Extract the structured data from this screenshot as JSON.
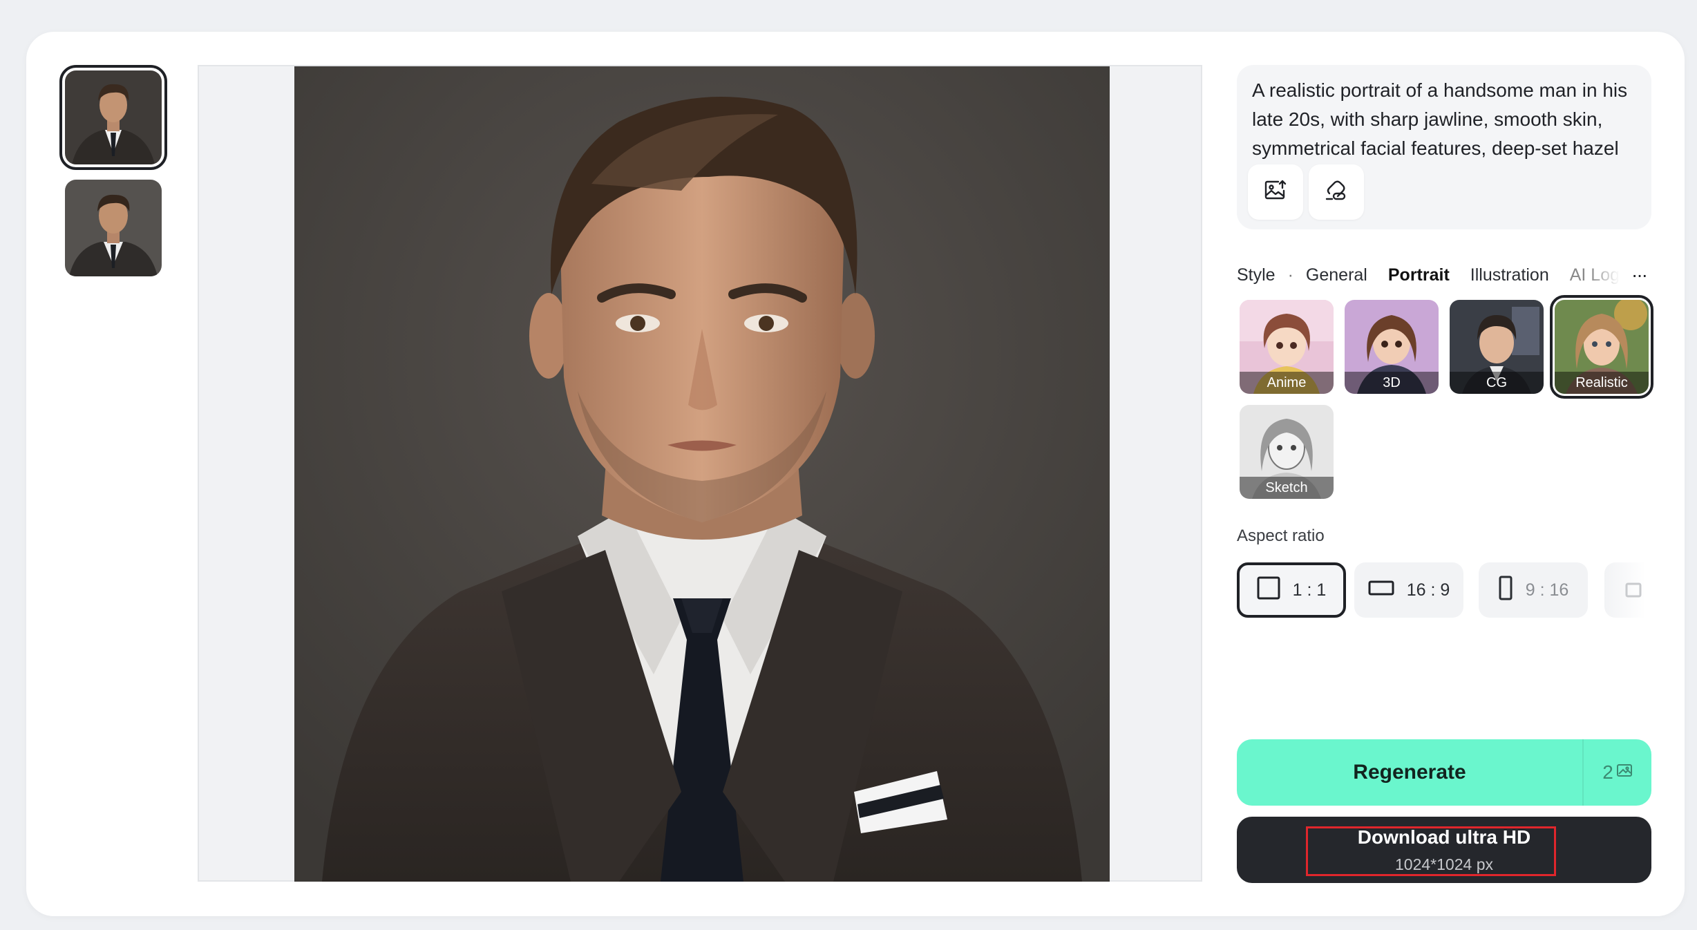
{
  "history": {
    "thumbnails": [
      {
        "name": "generated-portrait-1",
        "selected": true
      },
      {
        "name": "generated-portrait-2",
        "selected": false
      }
    ]
  },
  "prompt": {
    "text": "A realistic portrait of a handsome man in his late 20s, with sharp jawline, smooth skin, symmetrical facial features, deep-set hazel",
    "tools": [
      "image-upload-icon",
      "eraser-icon"
    ]
  },
  "style": {
    "label": "Style",
    "separator": "·",
    "tabs": [
      "General",
      "Portrait",
      "Illustration",
      "AI Log"
    ],
    "active_tab": "Portrait",
    "more": "···",
    "options": [
      {
        "label": "Anime",
        "selected": false
      },
      {
        "label": "3D",
        "selected": false
      },
      {
        "label": "CG",
        "selected": false
      },
      {
        "label": "Realistic",
        "selected": true
      },
      {
        "label": "Sketch",
        "selected": false
      }
    ]
  },
  "aspect": {
    "label": "Aspect ratio",
    "options": [
      {
        "label": "1 : 1",
        "selected": true
      },
      {
        "label": "16 : 9",
        "selected": false
      },
      {
        "label": "9 : 16",
        "selected": false
      }
    ]
  },
  "actions": {
    "regenerate_label": "Regenerate",
    "regenerate_cost": "2",
    "download_label": "Download ultra HD",
    "download_size": "1024*1024 px"
  },
  "colors": {
    "accent": "#6af6cd",
    "dark_button": "#25272c",
    "highlight": "#e0262c"
  }
}
